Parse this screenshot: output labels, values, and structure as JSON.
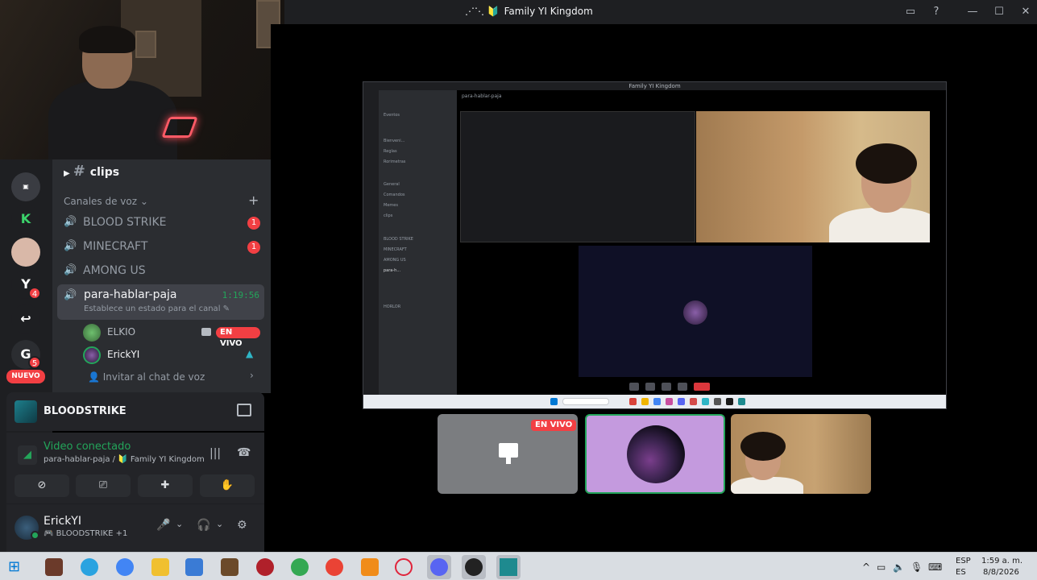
{
  "window": {
    "title": "Family YI Kingdom",
    "buttons": [
      "inbox-icon",
      "help-icon",
      "minimize-icon",
      "maximize-icon",
      "close-icon"
    ]
  },
  "channels": {
    "text_channel": "clips",
    "voice_category": "Canales de voz",
    "voice_channels": [
      {
        "name": "BLOOD STRIKE",
        "badge": "1"
      },
      {
        "name": "MINECRAFT",
        "badge": "1"
      },
      {
        "name": "AMONG US",
        "badge": ""
      }
    ],
    "active_channel": {
      "name": "para-hablar-paja",
      "timer": "1:19:56",
      "status": "Establece un estado para el canal"
    },
    "members": [
      {
        "name": "ELKIO",
        "live": "EN VIVO"
      },
      {
        "name": "ErickYI"
      }
    ],
    "invite": "Invitar al chat de voz"
  },
  "servers": {
    "badges": [
      "4",
      "5"
    ],
    "letter": "G",
    "new_label": "NUEVO"
  },
  "activity": {
    "title": "BLOODSTRIKE"
  },
  "voice_panel": {
    "status": "Video conectado",
    "path": "para-hablar-paja / 🔰 Family YI Kingdom"
  },
  "user": {
    "name": "ErickYI",
    "game": "BLOODSTRIKE +1",
    "status_color": "#23a55a"
  },
  "stage": {
    "share_title": "Family YI Kingdom",
    "share_channel": "para-hablar-paja",
    "thumb_live": "EN VIVO",
    "share_sidebar": [
      "Eventos",
      "Bienveni...",
      "Reglas",
      "Rorimetras",
      "General",
      "Comandos",
      "Memes",
      "clips",
      "BLOOD STRIKE",
      "MINECRAFT",
      "AMONG US",
      "para-h...",
      "HORLOR"
    ]
  },
  "taskbar": {
    "lang1": "ESP",
    "lang2": "ES",
    "time": "1:59 a. m.",
    "date": "8/8/2026"
  },
  "colors": {
    "accent_green": "#23a55a",
    "live_red": "#f23f43",
    "bg_sidebar": "#2b2d31"
  }
}
